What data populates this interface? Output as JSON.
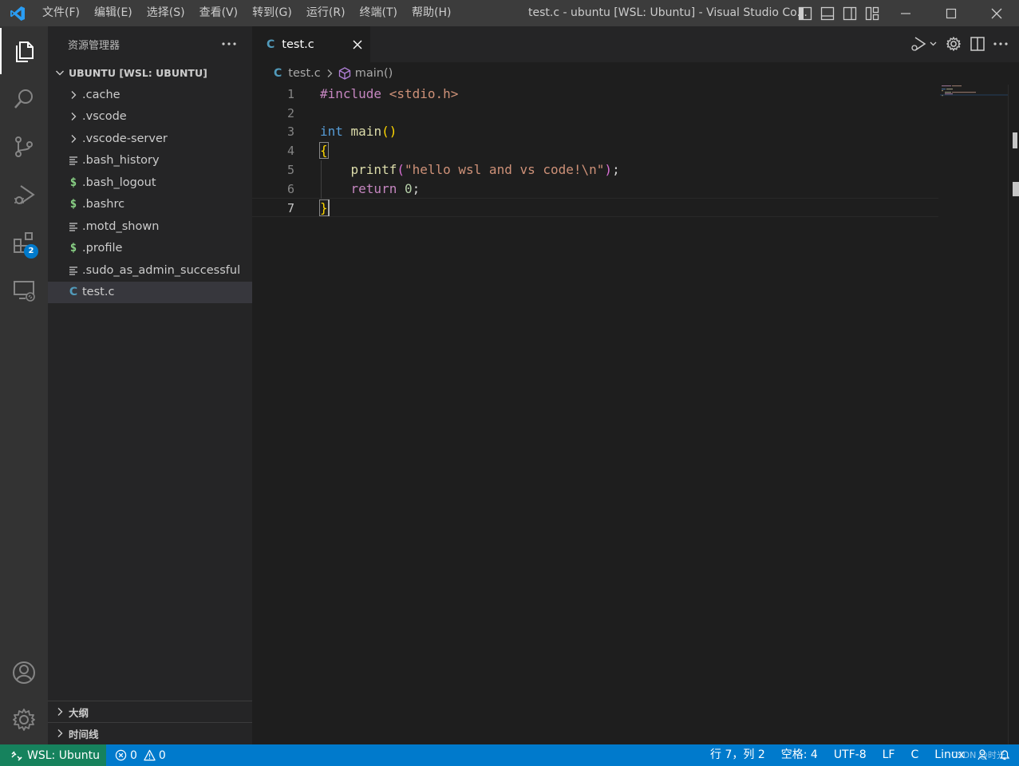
{
  "menu": [
    "文件(F)",
    "编辑(E)",
    "选择(S)",
    "查看(V)",
    "转到(G)",
    "运行(R)",
    "终端(T)",
    "帮助(H)"
  ],
  "window_title": "test.c - ubuntu [WSL: Ubuntu] - Visual Studio Co...",
  "colors": {
    "accent": "#007acc",
    "remote": "#16825d",
    "activity_bar": "#333333",
    "sidebar": "#252526",
    "editor": "#1e1e1e"
  },
  "activity_bar": {
    "extensions_badge": "2"
  },
  "sidebar": {
    "title": "资源管理器",
    "section": "UBUNTU [WSL: UBUNTU]",
    "files": [
      {
        "name": ".cache",
        "icon": "chevron-right-icon"
      },
      {
        "name": ".vscode",
        "icon": "chevron-right-icon"
      },
      {
        "name": ".vscode-server",
        "icon": "chevron-right-icon"
      },
      {
        "name": ".bash_history",
        "icon": "lines-icon"
      },
      {
        "name": ".bash_logout",
        "icon": "dollar-icon"
      },
      {
        "name": ".bashrc",
        "icon": "dollar-icon"
      },
      {
        "name": ".motd_shown",
        "icon": "lines-icon"
      },
      {
        "name": ".profile",
        "icon": "dollar-icon"
      },
      {
        "name": ".sudo_as_admin_successful",
        "icon": "lines-icon"
      },
      {
        "name": "test.c",
        "icon": "c-icon"
      }
    ],
    "outline": "大纲",
    "timeline": "时间线"
  },
  "editor": {
    "tab": "test.c",
    "breadcrumb_file": "test.c",
    "breadcrumb_symbol": "main()",
    "lines": [
      "1",
      "2",
      "3",
      "4",
      "5",
      "6",
      "7"
    ],
    "code": {
      "l1_kw": "#include",
      "l1_hdr": " <stdio.h>",
      "l3_type": "int",
      "l3_fn": " main",
      "l3_paren": "()",
      "l4_brace": "{",
      "l5_fn": "    printf",
      "l5_open": "(",
      "l5_str": "\"hello wsl and vs code!\\n\"",
      "l5_close": ")",
      "l5_semi": ";",
      "l6_kw": "    return",
      "l6_num": " 0",
      "l6_semi": ";",
      "l7_brace": "}"
    }
  },
  "status": {
    "remote": "WSL: Ubuntu",
    "errors": "0",
    "warnings": "0",
    "position": "行 7，列 2",
    "spaces": "空格: 4",
    "encoding": "UTF-8",
    "eol": "LF",
    "language": "C",
    "os": "Linux",
    "watermark": "CSDN @时光"
  }
}
